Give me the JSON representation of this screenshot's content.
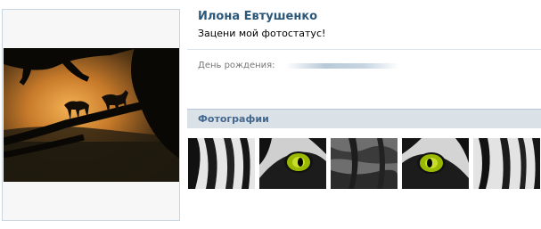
{
  "profile": {
    "name": "Илона Евтушенко",
    "status": "Зацени мой фотостатус!",
    "birthday_label": "День рождения:"
  },
  "photos": {
    "header": "Фотографии",
    "items": [
      {
        "subject": "tiger-fur-stripes"
      },
      {
        "subject": "tiger-eye-left"
      },
      {
        "subject": "tiger-fur-close"
      },
      {
        "subject": "tiger-eye-right"
      },
      {
        "subject": "tiger-fur-stripes-2"
      }
    ]
  },
  "colors": {
    "name": "#2b587a",
    "header_bg": "#dae2e8",
    "header_text": "#45688e",
    "eye": "#b9d100"
  }
}
